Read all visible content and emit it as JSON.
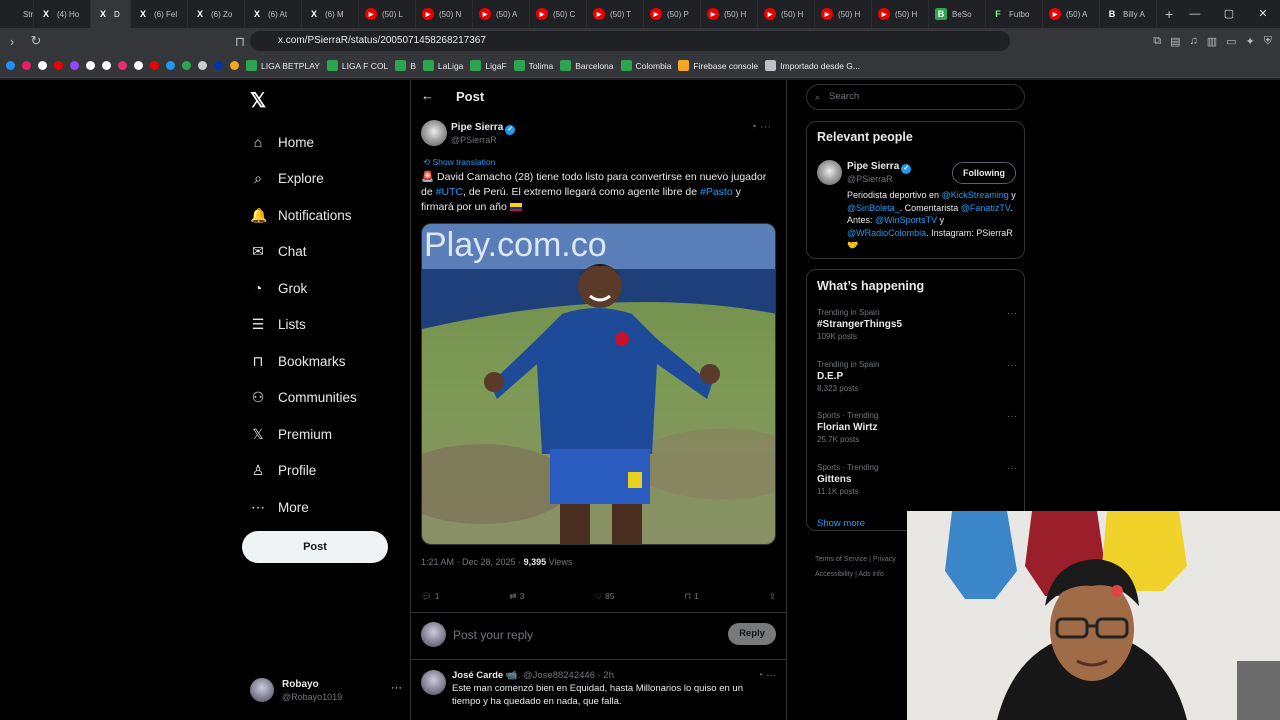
{
  "browser": {
    "tabs": [
      {
        "icon": "",
        "label": "Strea"
      },
      {
        "icon": "X",
        "label": "(4) Ho"
      },
      {
        "icon": "X",
        "label": "D"
      },
      {
        "icon": "X",
        "label": "(6) Fel"
      },
      {
        "icon": "X",
        "label": "(6) Zo"
      },
      {
        "icon": "X",
        "label": "(6) At"
      },
      {
        "icon": "X",
        "label": "(6) M"
      },
      {
        "icon": "▶",
        "label": "(50) L"
      },
      {
        "icon": "▶",
        "label": "(50) N"
      },
      {
        "icon": "▶",
        "label": "(50) A"
      },
      {
        "icon": "▶",
        "label": "(50) C"
      },
      {
        "icon": "▶",
        "label": "(50) T"
      },
      {
        "icon": "▶",
        "label": "(50) P"
      },
      {
        "icon": "▶",
        "label": "(50) H"
      },
      {
        "icon": "▶",
        "label": "(50) H"
      },
      {
        "icon": "▶",
        "label": "(50) H"
      },
      {
        "icon": "▶",
        "label": "(50) H"
      },
      {
        "icon": "B",
        "label": "BeSo"
      },
      {
        "icon": "F",
        "label": "Futbo"
      },
      {
        "icon": "▶",
        "label": "(50) A"
      },
      {
        "icon": "B",
        "label": "Billy A"
      }
    ],
    "url": "x.com/PSierraR/status/2005071458268217367",
    "bookmarks": [
      {
        "label": "LIGA BETPLAY",
        "color": "#2ea44f"
      },
      {
        "label": "LIGA F COL",
        "color": "#2ea44f"
      },
      {
        "label": "B",
        "color": "#2ea44f"
      },
      {
        "label": "LaLiga",
        "color": "#2ea44f"
      },
      {
        "label": "LigaF",
        "color": "#2ea44f"
      },
      {
        "label": "Tolima",
        "color": "#2ea44f"
      },
      {
        "label": "Barcelona",
        "color": "#2ea44f"
      },
      {
        "label": "Colombia",
        "color": "#2ea44f"
      },
      {
        "label": "Firebase console",
        "color": "#f5a623"
      },
      {
        "label": "Importado desde G...",
        "color": "#bdc1c6"
      }
    ]
  },
  "nav": {
    "items": [
      {
        "label": "Home",
        "icon": "⌂"
      },
      {
        "label": "Explore",
        "icon": "⌕"
      },
      {
        "label": "Notifications",
        "icon": "🔔"
      },
      {
        "label": "Chat",
        "icon": "✉"
      },
      {
        "label": "Grok",
        "icon": "◔"
      },
      {
        "label": "Lists",
        "icon": "☰"
      },
      {
        "label": "Bookmarks",
        "icon": "⊓"
      },
      {
        "label": "Communities",
        "icon": "⚇"
      },
      {
        "label": "Premium",
        "icon": "𝕏"
      },
      {
        "label": "Profile",
        "icon": "♙"
      },
      {
        "label": "More",
        "icon": "⋯"
      }
    ],
    "post_button": "Post",
    "me": {
      "name": "Robayo",
      "handle": "@Robayo1019"
    }
  },
  "post": {
    "header": "Post",
    "author": "Pipe Sierra",
    "handle": "@PSierraR",
    "translate": "Show translation",
    "text_1": "David Camacho (28) tiene todo listo para convertirse en nuevo jugador de ",
    "tag_utc": "#UTC",
    "text_2": ", de Perú. El extremo llegará como agente libre de ",
    "tag_pasto": "#Pasto",
    "text_3": " y firmará por un año",
    "photo_banner": "Play.com.co",
    "time": "1:21 AM · Dec 28, 2025 · ",
    "views": "9,395",
    "views_label": " Views",
    "replies": "1",
    "reposts": "3",
    "likes": "85",
    "bookmarks": "1",
    "reply_placeholder": "Post your reply",
    "reply_button": "Reply"
  },
  "comment": {
    "name": "José Carde",
    "handle": "@Jose88242446 · 2h",
    "text": "Este man comenzó bien en Equidad, hasta Millonarios lo quiso en un tiempo y ha quedado en nada, que falla."
  },
  "sidebar": {
    "search_placeholder": "Search",
    "relevant_title": "Relevant people",
    "person_name": "Pipe Sierra",
    "person_handle": "@PSierraR",
    "follow_label": "Following",
    "bio_1": "Periodista deportivo en ",
    "bio_l1": "@KickStreaming",
    "bio_2": " y ",
    "bio_l2": "@SinBoleta_",
    "bio_3": ". Comentarista ",
    "bio_l3": "@FanatizTV",
    "bio_4": ". Antes: ",
    "bio_l4": "@WinSportsTV",
    "bio_5": " y ",
    "bio_l5": "@WRadioColombia",
    "bio_6": ". Instagram: PSierraR 🤝",
    "happening_title": "What’s happening",
    "trends": [
      {
        "context": "Trending in Spain",
        "name": "#StrangerThings5",
        "posts": "109K posts"
      },
      {
        "context": "Trending in Spain",
        "name": "D.E.P",
        "posts": "8,323 posts"
      },
      {
        "context": "Sports · Trending",
        "name": "Florian Wirtz",
        "posts": "25.7K posts"
      },
      {
        "context": "Sports · Trending",
        "name": "Gittens",
        "posts": "11.1K posts"
      }
    ],
    "show_more": "Show more",
    "footer_1": "Terms of Service | Privacy",
    "footer_2": "Accessibility | Ads info"
  }
}
